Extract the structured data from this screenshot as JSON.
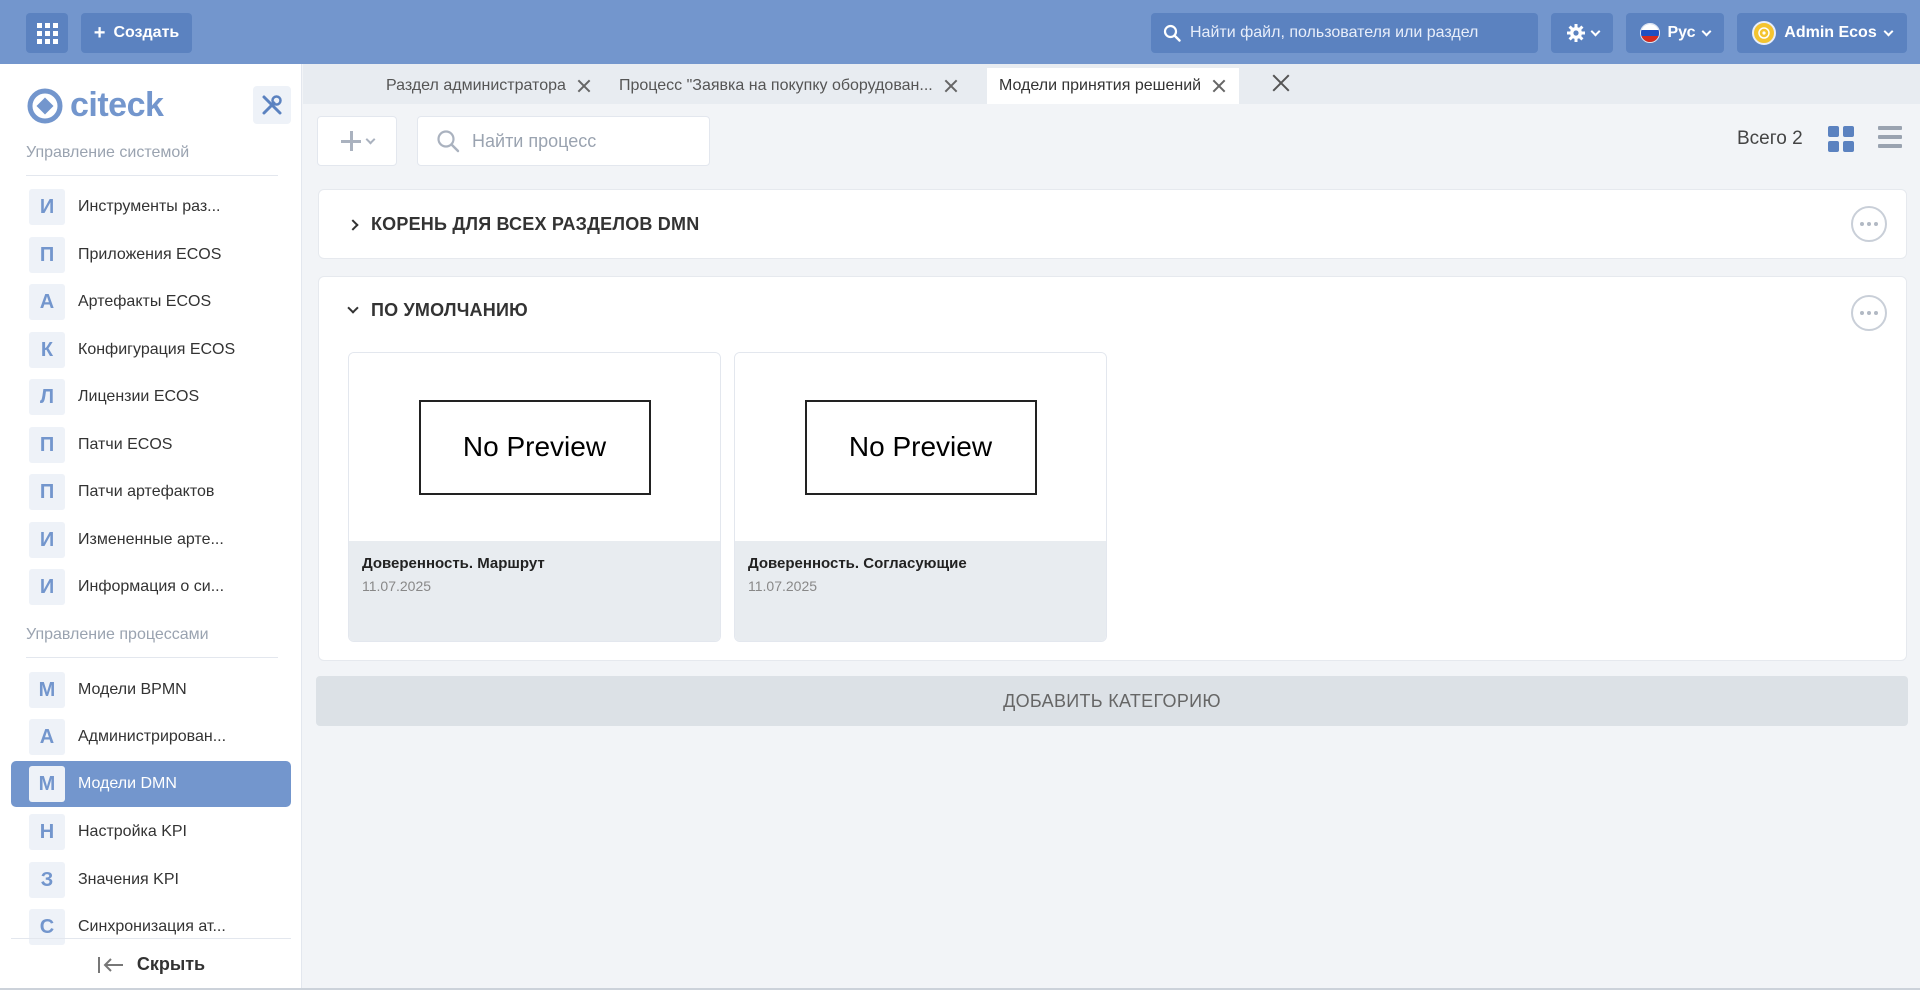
{
  "header": {
    "create_label": "Создать",
    "search_placeholder": "Найти файл, пользователя или раздел",
    "lang_label": "Рус",
    "user_name": "Admin Ecos"
  },
  "sidebar": {
    "logo_text": "citeck",
    "groups": [
      {
        "title": "Управление системой",
        "items": [
          {
            "letter": "И",
            "label": "Инструменты раз..."
          },
          {
            "letter": "П",
            "label": "Приложения ECOS"
          },
          {
            "letter": "А",
            "label": "Артефакты ECOS"
          },
          {
            "letter": "К",
            "label": "Конфигурация ECOS"
          },
          {
            "letter": "Л",
            "label": "Лицензии ECOS"
          },
          {
            "letter": "П",
            "label": "Патчи ECOS"
          },
          {
            "letter": "П",
            "label": "Патчи артефактов"
          },
          {
            "letter": "И",
            "label": "Измененные арте..."
          },
          {
            "letter": "И",
            "label": "Информация о си..."
          }
        ]
      },
      {
        "title": "Управление процессами",
        "items": [
          {
            "letter": "М",
            "label": "Модели BPMN"
          },
          {
            "letter": "А",
            "label": "Администрирован..."
          },
          {
            "letter": "М",
            "label": "Модели DMN"
          },
          {
            "letter": "Н",
            "label": "Настройка KPI"
          },
          {
            "letter": "З",
            "label": "Значения KPI"
          },
          {
            "letter": "С",
            "label": "Синхронизация ат..."
          }
        ]
      }
    ],
    "active_item": "Модели DMN",
    "hide_label": "Скрыть"
  },
  "tabs": [
    {
      "label": "Раздел администратора",
      "active": false
    },
    {
      "label": "Процесс \"Заявка на покупку оборудован...",
      "active": false
    },
    {
      "label": "Модели принятия решений",
      "active": true
    }
  ],
  "toolbar": {
    "search_placeholder": "Найти процесс",
    "total_label": "Всего 2"
  },
  "categories": [
    {
      "title": "КОРЕНЬ ДЛЯ ВСЕХ РАЗДЕЛОВ DMN",
      "expanded": false,
      "cards": []
    },
    {
      "title": "ПО УМОЛЧАНИЮ",
      "expanded": true,
      "cards": [
        {
          "preview_text": "No Preview",
          "title": "Доверенность. Маршрут",
          "date": "11.07.2025"
        },
        {
          "preview_text": "No Preview",
          "title": "Доверенность. Согласующие",
          "date": "11.07.2025"
        }
      ]
    }
  ],
  "add_category_label": "ДОБАВИТЬ КАТЕГОРИЮ",
  "colors": {
    "accent": "#7396cd",
    "accent_dark": "#5b82c0",
    "background": "#f2f4f7"
  }
}
